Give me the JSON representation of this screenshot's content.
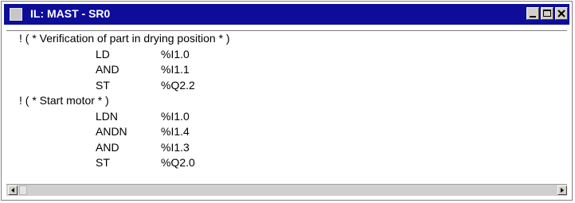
{
  "window": {
    "title": "IL: MAST - SR0",
    "controls": [
      "minimize-icon",
      "maximize-icon",
      "close-icon"
    ]
  },
  "code": [
    {
      "kind": "comment",
      "text": "! ( * Verification of part in drying position * )"
    },
    {
      "kind": "instruction",
      "op": "LD",
      "operand": "%I1.0"
    },
    {
      "kind": "instruction",
      "op": "AND",
      "operand": "%I1.1"
    },
    {
      "kind": "instruction",
      "op": "ST",
      "operand": "%Q2.2"
    },
    {
      "kind": "comment",
      "text": "! ( * Start motor * )"
    },
    {
      "kind": "instruction",
      "op": "LDN",
      "operand": "%I1.0"
    },
    {
      "kind": "instruction",
      "op": "ANDN",
      "operand": "%I1.4"
    },
    {
      "kind": "instruction",
      "op": "AND",
      "operand": "%I1.3"
    },
    {
      "kind": "instruction",
      "op": "ST",
      "operand": "%Q2.0"
    }
  ],
  "colors": {
    "titlebar": "#0d0d9a",
    "title_text": "#ffffff",
    "background": "#ffffff",
    "scrollbar": "#cfcfcf"
  }
}
